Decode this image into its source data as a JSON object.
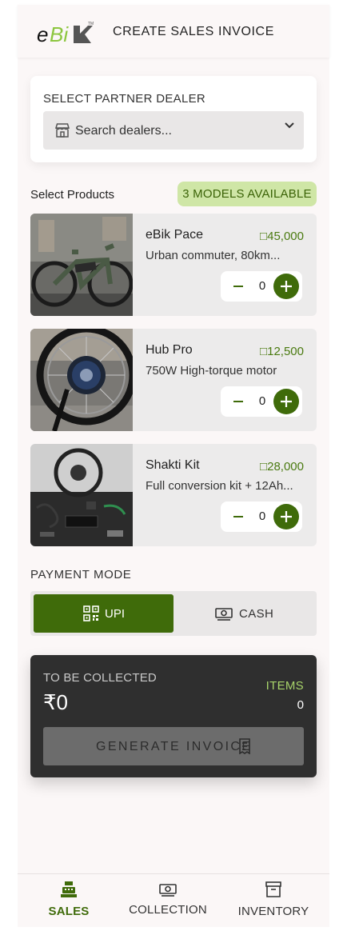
{
  "header": {
    "logo_text": "eBik",
    "title": "CREATE SALES INVOICE"
  },
  "dealer": {
    "label": "SELECT PARTNER DEALER",
    "placeholder": "Search dealers...",
    "store_icon": "store-icon",
    "chevron_icon": "chevron-down-icon"
  },
  "products": {
    "heading": "Select Products",
    "badge": "3 MODELS AVAILABLE",
    "items": [
      {
        "name": "eBik Pace",
        "price": "□45,000",
        "desc": "Urban commuter, 80km...",
        "qty": "0"
      },
      {
        "name": "Hub Pro",
        "price": "□12,500",
        "desc": "750W High-torque motor",
        "qty": "0"
      },
      {
        "name": "Shakti Kit",
        "price": "□28,000",
        "desc": "Full conversion kit + 12Ah...",
        "qty": "0"
      }
    ]
  },
  "payment": {
    "label": "PAYMENT MODE",
    "upi": "UPI",
    "cash": "CASH",
    "selected": "UPI"
  },
  "summary": {
    "to_be_collected": "TO BE COLLECTED",
    "amount": "₹0",
    "items_label": "ITEMS",
    "items_value": "0",
    "generate": "GENERATE INVOICE"
  },
  "nav": {
    "sales": "SALES",
    "collection": "COLLECTION",
    "inventory": "INVENTORY",
    "active": "SALES"
  },
  "colors": {
    "accent": "#3f6b0a",
    "badge_bg": "#cfe6a6",
    "price": "#4a7a10",
    "dark_card": "#2f2f2f"
  }
}
